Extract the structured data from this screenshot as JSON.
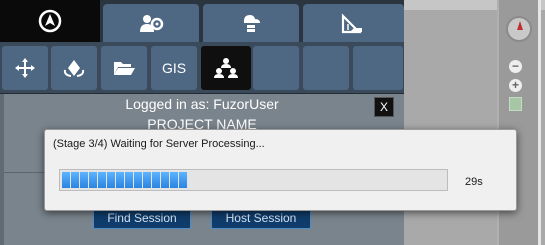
{
  "top_tabs": [
    {
      "icon": "navigate-circle-icon",
      "active": true
    },
    {
      "icon": "people-settings-icon",
      "active": false
    },
    {
      "icon": "cloud-server-icon",
      "active": false
    },
    {
      "icon": "ruler-protractor-icon",
      "active": false
    }
  ],
  "toolbar": {
    "items": [
      {
        "icon": "move-arrows-icon",
        "label": ""
      },
      {
        "icon": "rotate-icon",
        "label": ""
      },
      {
        "icon": "folder-open-icon",
        "label": ""
      },
      {
        "icon": "",
        "label": "GIS"
      },
      {
        "icon": "collaboration-icon",
        "label": "",
        "active": true
      }
    ]
  },
  "panel": {
    "logged_in": "Logged in as: FuzorUser",
    "project_name": "PROJECT NAME",
    "close_label": "X",
    "find_session": "Find Session",
    "host_session": "Host Session"
  },
  "dialog": {
    "title": "(Stage 3/4) Waiting for Server Processing...",
    "progress_fraction": 0.32,
    "time_remaining": "29s",
    "accent": "#2f8cf0"
  },
  "map_controls": {
    "zoom_in": "+",
    "zoom_out": "−",
    "compass": "compass-icon"
  }
}
